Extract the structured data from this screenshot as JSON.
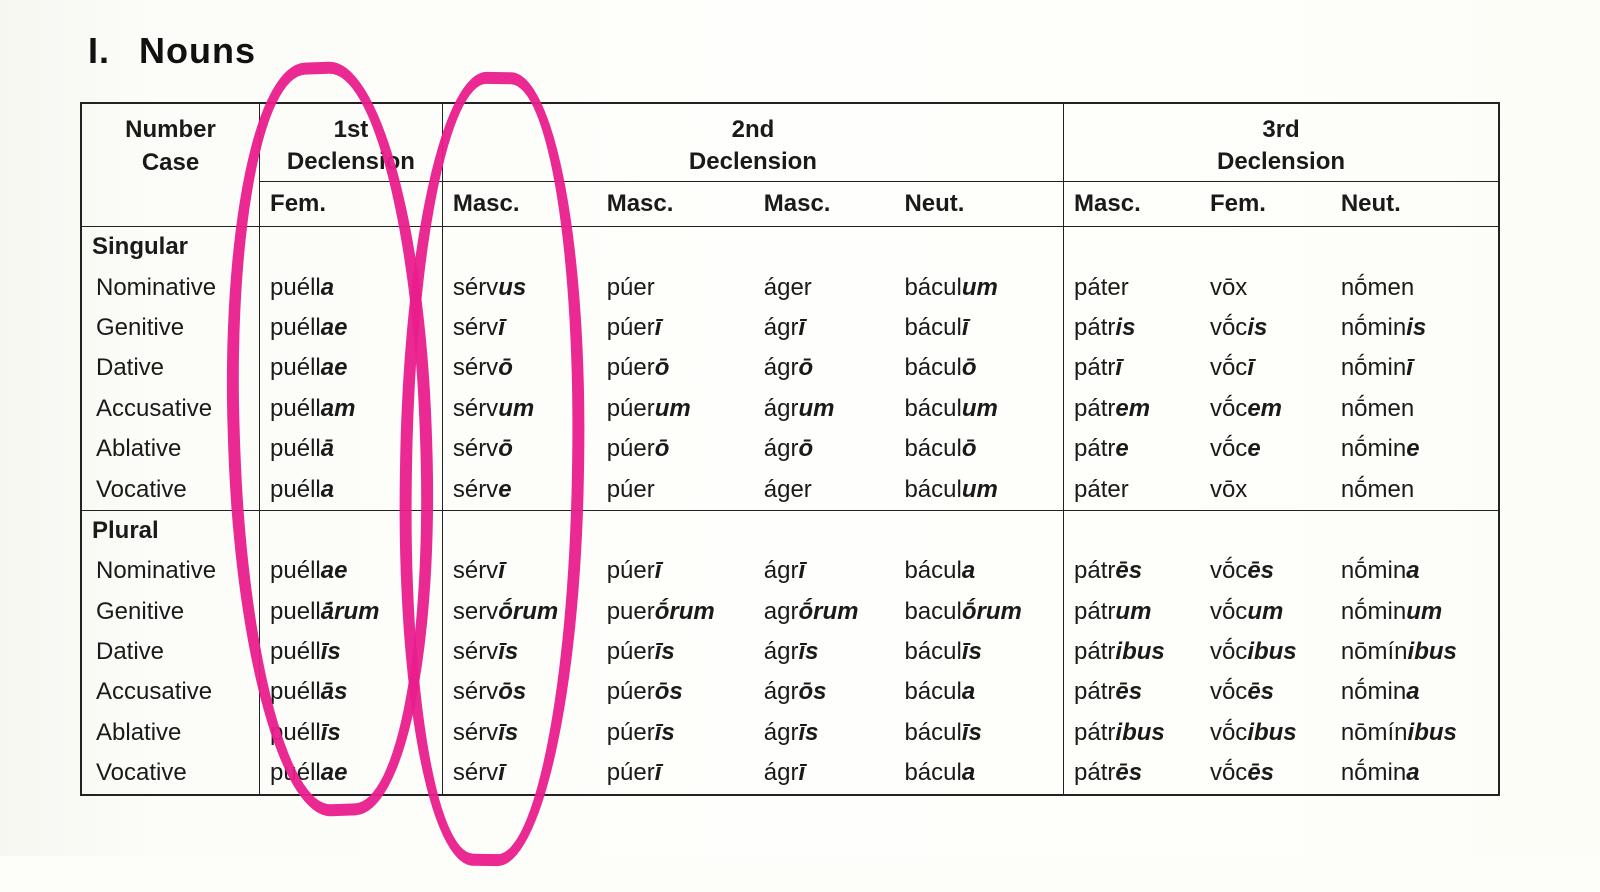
{
  "title_roman": "I.",
  "title_text": "Nouns",
  "header": {
    "ncase_l1": "Number",
    "ncase_l2": "Case",
    "d1": "1st",
    "d2": "2nd",
    "d3": "3rd",
    "decl": "Declension",
    "fem": "Fem.",
    "masc": "Masc.",
    "neut": "Neut."
  },
  "sections": {
    "singular": "Singular",
    "plural": "Plural"
  },
  "cases": {
    "nom": "Nominative",
    "gen": "Genitive",
    "dat": "Dative",
    "acc": "Accusative",
    "abl": "Ablative",
    "voc": "Vocative"
  },
  "chart_data": {
    "type": "table",
    "title": "Latin Noun Declensions",
    "row_labels_number": [
      "Singular",
      "Singular",
      "Singular",
      "Singular",
      "Singular",
      "Singular",
      "Plural",
      "Plural",
      "Plural",
      "Plural",
      "Plural",
      "Plural"
    ],
    "row_labels_case": [
      "Nominative",
      "Genitive",
      "Dative",
      "Accusative",
      "Ablative",
      "Vocative",
      "Nominative",
      "Genitive",
      "Dative",
      "Accusative",
      "Ablative",
      "Vocative"
    ],
    "columns": [
      {
        "declension": "1st",
        "gender": "Fem.",
        "paradigm": "puella"
      },
      {
        "declension": "2nd",
        "gender": "Masc.",
        "paradigm": "servus"
      },
      {
        "declension": "2nd",
        "gender": "Masc.",
        "paradigm": "puer"
      },
      {
        "declension": "2nd",
        "gender": "Masc.",
        "paradigm": "ager"
      },
      {
        "declension": "2nd",
        "gender": "Neut.",
        "paradigm": "baculum"
      },
      {
        "declension": "3rd",
        "gender": "Masc.",
        "paradigm": "pater"
      },
      {
        "declension": "3rd",
        "gender": "Fem.",
        "paradigm": "vox"
      },
      {
        "declension": "3rd",
        "gender": "Neut.",
        "paradigm": "nomen"
      }
    ],
    "cells": [
      [
        [
          "puéll",
          "a"
        ],
        [
          "sérv",
          "us"
        ],
        [
          "púer",
          ""
        ],
        [
          "áger",
          ""
        ],
        [
          "bácul",
          "um"
        ],
        [
          "páter",
          ""
        ],
        [
          "vōx",
          ""
        ],
        [
          "nṓmen",
          ""
        ]
      ],
      [
        [
          "puéll",
          "ae"
        ],
        [
          "sérv",
          "ī"
        ],
        [
          "púer",
          "ī"
        ],
        [
          "ágr",
          "ī"
        ],
        [
          "bácul",
          "ī"
        ],
        [
          "pátr",
          "is"
        ],
        [
          "vṓc",
          "is"
        ],
        [
          "nṓmin",
          "is"
        ]
      ],
      [
        [
          "puéll",
          "ae"
        ],
        [
          "sérv",
          "ō"
        ],
        [
          "púer",
          "ō"
        ],
        [
          "ágr",
          "ō"
        ],
        [
          "bácul",
          "ō"
        ],
        [
          "pátr",
          "ī"
        ],
        [
          "vṓc",
          "ī"
        ],
        [
          "nṓmin",
          "ī"
        ]
      ],
      [
        [
          "puéll",
          "am"
        ],
        [
          "sérv",
          "um"
        ],
        [
          "púer",
          "um"
        ],
        [
          "ágr",
          "um"
        ],
        [
          "bácul",
          "um"
        ],
        [
          "pátr",
          "em"
        ],
        [
          "vṓc",
          "em"
        ],
        [
          "nṓmen",
          ""
        ]
      ],
      [
        [
          "puéll",
          "ā"
        ],
        [
          "sérv",
          "ō"
        ],
        [
          "púer",
          "ō"
        ],
        [
          "ágr",
          "ō"
        ],
        [
          "bácul",
          "ō"
        ],
        [
          "pátr",
          "e"
        ],
        [
          "vṓc",
          "e"
        ],
        [
          "nṓmin",
          "e"
        ]
      ],
      [
        [
          "puéll",
          "a"
        ],
        [
          "sérv",
          "e"
        ],
        [
          "púer",
          ""
        ],
        [
          "áger",
          ""
        ],
        [
          "bácul",
          "um"
        ],
        [
          "páter",
          ""
        ],
        [
          "vōx",
          ""
        ],
        [
          "nṓmen",
          ""
        ]
      ],
      [
        [
          "puéll",
          "ae"
        ],
        [
          "sérv",
          "ī"
        ],
        [
          "púer",
          "ī"
        ],
        [
          "ágr",
          "ī"
        ],
        [
          "bácul",
          "a"
        ],
        [
          "pátr",
          "ēs"
        ],
        [
          "vṓc",
          "ēs"
        ],
        [
          "nṓmin",
          "a"
        ]
      ],
      [
        [
          "puell",
          "ā́rum"
        ],
        [
          "serv",
          "ṓrum"
        ],
        [
          "puer",
          "ṓrum"
        ],
        [
          "agr",
          "ṓrum"
        ],
        [
          "bacul",
          "ṓrum"
        ],
        [
          "pátr",
          "um"
        ],
        [
          "vṓc",
          "um"
        ],
        [
          "nṓmin",
          "um"
        ]
      ],
      [
        [
          "puéll",
          "īs"
        ],
        [
          "sérv",
          "īs"
        ],
        [
          "púer",
          "īs"
        ],
        [
          "ágr",
          "īs"
        ],
        [
          "bácul",
          "īs"
        ],
        [
          "pátr",
          "ibus"
        ],
        [
          "vṓc",
          "ibus"
        ],
        [
          "nōmín",
          "ibus"
        ]
      ],
      [
        [
          "puéll",
          "ās"
        ],
        [
          "sérv",
          "ōs"
        ],
        [
          "púer",
          "ōs"
        ],
        [
          "ágr",
          "ōs"
        ],
        [
          "bácul",
          "a"
        ],
        [
          "pátr",
          "ēs"
        ],
        [
          "vṓc",
          "ēs"
        ],
        [
          "nṓmin",
          "a"
        ]
      ],
      [
        [
          "puéll",
          "īs"
        ],
        [
          "sérv",
          "īs"
        ],
        [
          "púer",
          "īs"
        ],
        [
          "ágr",
          "īs"
        ],
        [
          "bácul",
          "īs"
        ],
        [
          "pátr",
          "ibus"
        ],
        [
          "vṓc",
          "ibus"
        ],
        [
          "nōmín",
          "ibus"
        ]
      ],
      [
        [
          "puéll",
          "ae"
        ],
        [
          "sérv",
          "ī"
        ],
        [
          "púer",
          "ī"
        ],
        [
          "ágr",
          "ī"
        ],
        [
          "bácul",
          "a"
        ],
        [
          "pátr",
          "ēs"
        ],
        [
          "vṓc",
          "ēs"
        ],
        [
          "nṓmin",
          "a"
        ]
      ]
    ],
    "annotations": [
      "hand-drawn pink circle around 1st Declension Fem. column",
      "hand-drawn pink circle around 2nd Declension first Masc. column"
    ]
  }
}
